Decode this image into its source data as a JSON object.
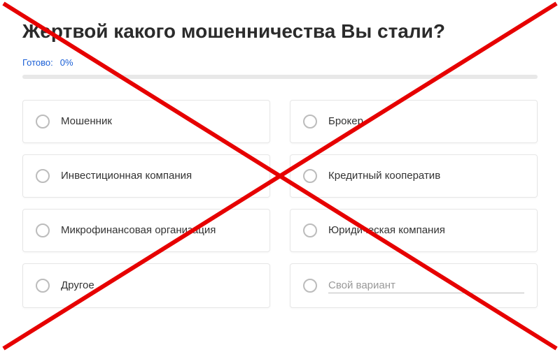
{
  "title": "Жертвой какого мошенничества Вы стали?",
  "progress": {
    "label": "Готово:",
    "value": "0%"
  },
  "options": [
    {
      "label": "Мошенник"
    },
    {
      "label": "Брокер"
    },
    {
      "label": "Инвестиционная компания"
    },
    {
      "label": "Кредитный кооператив"
    },
    {
      "label": "Микрофинансовая организация"
    },
    {
      "label": "Юридическая компания"
    },
    {
      "label": "Другое"
    }
  ],
  "custom_option": {
    "placeholder": "Свой вариант"
  },
  "overlay": {
    "type": "red-x",
    "color": "#e60000"
  }
}
